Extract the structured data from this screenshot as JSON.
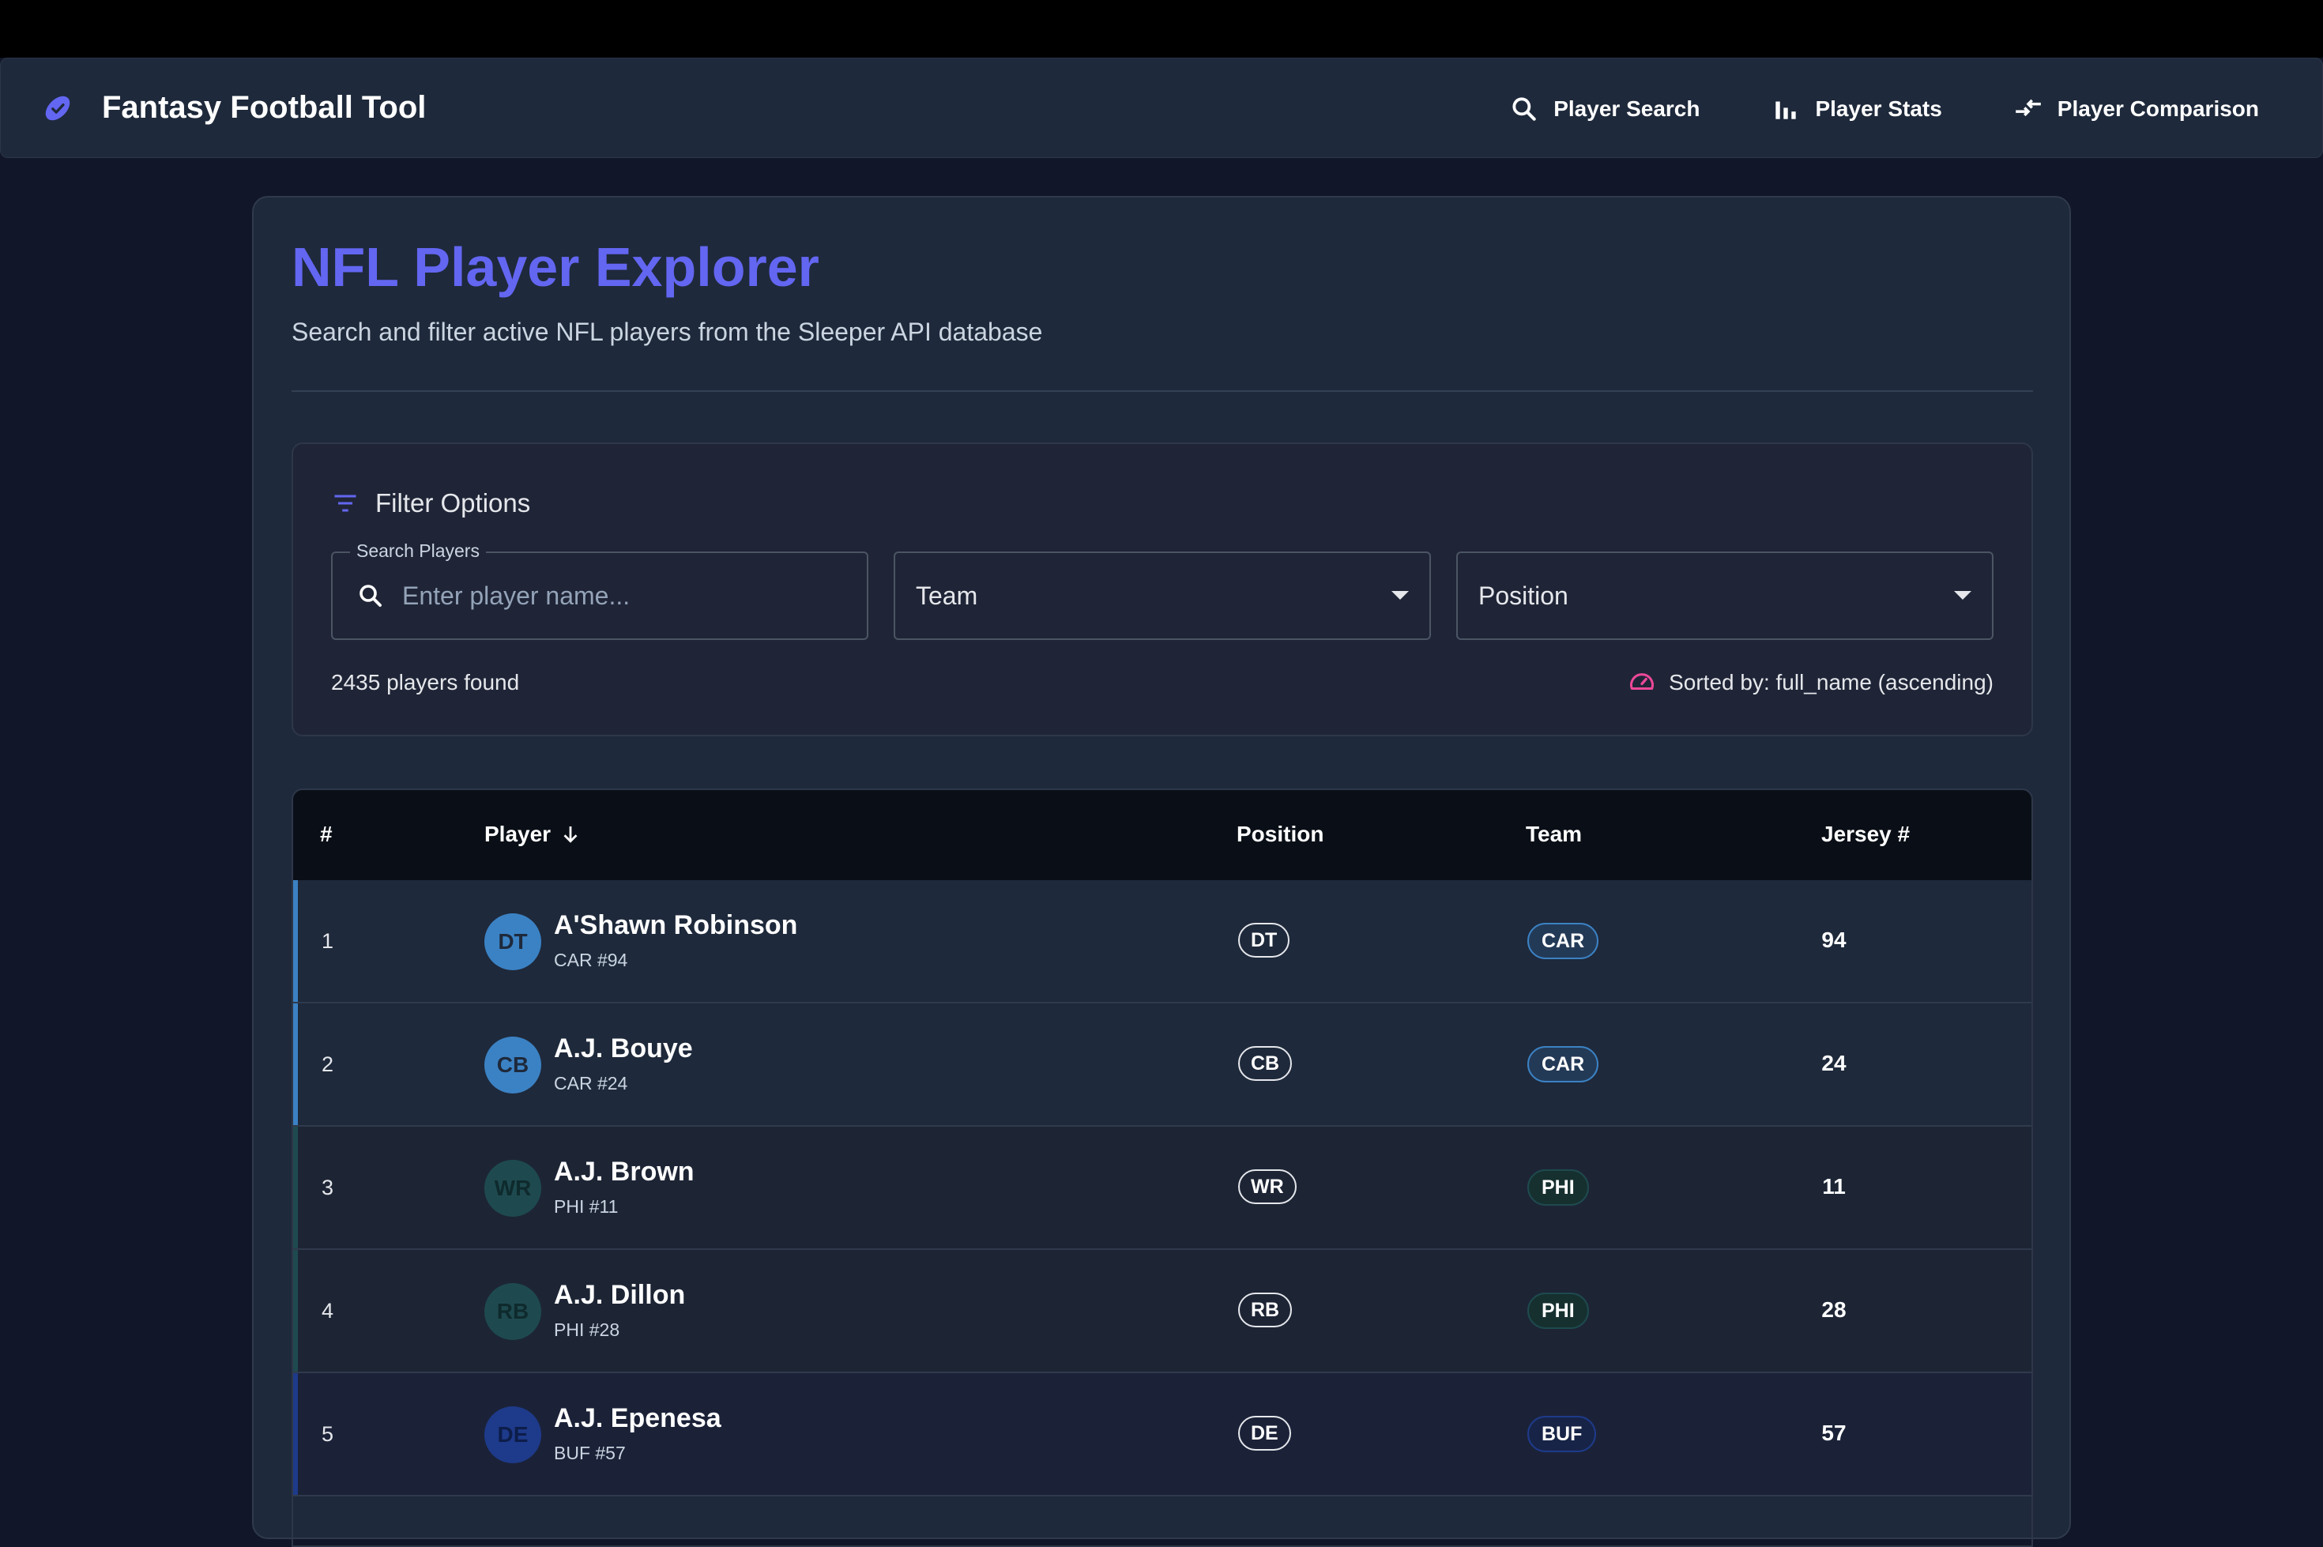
{
  "app": {
    "title": "Fantasy Football Tool",
    "nav": [
      {
        "label": "Player Search",
        "icon": "search-icon"
      },
      {
        "label": "Player Stats",
        "icon": "bar-chart-icon"
      },
      {
        "label": "Player Comparison",
        "icon": "compare-arrows-icon"
      }
    ]
  },
  "page": {
    "title": "NFL Player Explorer",
    "subtitle": "Search and filter active NFL players from the Sleeper API database"
  },
  "filters": {
    "title": "Filter Options",
    "search_label": "Search Players",
    "search_placeholder": "Enter player name...",
    "search_value": "",
    "team_label": "Team",
    "position_label": "Position",
    "count_text": "2435 players found",
    "sorted_text": "Sorted by: full_name (ascending)"
  },
  "table": {
    "headers": {
      "num": "#",
      "player": "Player",
      "position": "Position",
      "team": "Team",
      "jersey": "Jersey #"
    },
    "rows": [
      {
        "num": "1",
        "initials": "DT",
        "name": "A'Shawn Robinson",
        "sub": "CAR #94",
        "position": "DT",
        "team": "CAR",
        "jersey": "94"
      },
      {
        "num": "2",
        "initials": "CB",
        "name": "A.J. Bouye",
        "sub": "CAR #24",
        "position": "CB",
        "team": "CAR",
        "jersey": "24"
      },
      {
        "num": "3",
        "initials": "WR",
        "name": "A.J. Brown",
        "sub": "PHI #11",
        "position": "WR",
        "team": "PHI",
        "jersey": "11"
      },
      {
        "num": "4",
        "initials": "RB",
        "name": "A.J. Dillon",
        "sub": "PHI #28",
        "position": "RB",
        "team": "PHI",
        "jersey": "28"
      },
      {
        "num": "5",
        "initials": "DE",
        "name": "A.J. Epenesa",
        "sub": "BUF #57",
        "position": "DE",
        "team": "BUF",
        "jersey": "57"
      }
    ]
  },
  "colors": {
    "accent": "#6366f1",
    "CAR": "#3b82c4",
    "PHI": "#1e4a4f",
    "BUF": "#1e3a8a",
    "sort_icon": "#ec4899"
  }
}
